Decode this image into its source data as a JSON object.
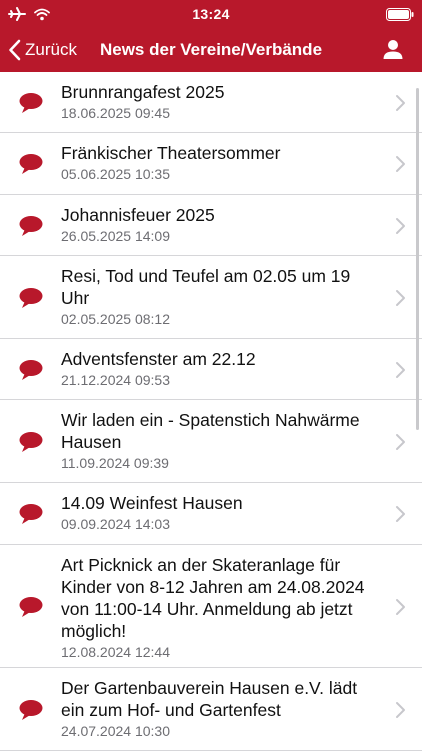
{
  "status_bar": {
    "time": "13:24",
    "left_icons": [
      "airplane-icon",
      "wifi-icon"
    ],
    "right_icons": [
      "battery-icon"
    ]
  },
  "nav": {
    "back_label": "Zurück",
    "title": "News der Vereine/Verbände",
    "right_icon": "profile-icon"
  },
  "colors": {
    "brand": "#b8182b",
    "date_text": "#6d6d72",
    "chevron": "#c7c7cc",
    "separator": "#d6d6d9"
  },
  "news": [
    {
      "title": "Brunnrangafest 2025",
      "date": "18.06.2025 09:45"
    },
    {
      "title": "Fränkischer Theatersommer",
      "date": "05.06.2025 10:35"
    },
    {
      "title": "Johannisfeuer 2025",
      "date": "26.05.2025 14:09"
    },
    {
      "title": "Resi, Tod und Teufel am 02.05 um 19 Uhr",
      "date": "02.05.2025 08:12"
    },
    {
      "title": "Adventsfenster am 22.12",
      "date": "21.12.2024 09:53"
    },
    {
      "title": "Wir laden ein - Spatenstich Nahwärme Hausen",
      "date": "11.09.2024 09:39"
    },
    {
      "title": "14.09 Weinfest Hausen",
      "date": "09.09.2024 14:03"
    },
    {
      "title": "Art Picknick an der Skateranlage für Kinder von 8-12 Jahren am 24.08.2024 von 11:00-14 Uhr. Anmeldung ab jetzt möglich!",
      "date": "12.08.2024 12:44"
    },
    {
      "title": "Der Gartenbauverein Hausen e.V. lädt ein zum Hof- und Gartenfest",
      "date": "24.07.2024 10:30"
    }
  ]
}
